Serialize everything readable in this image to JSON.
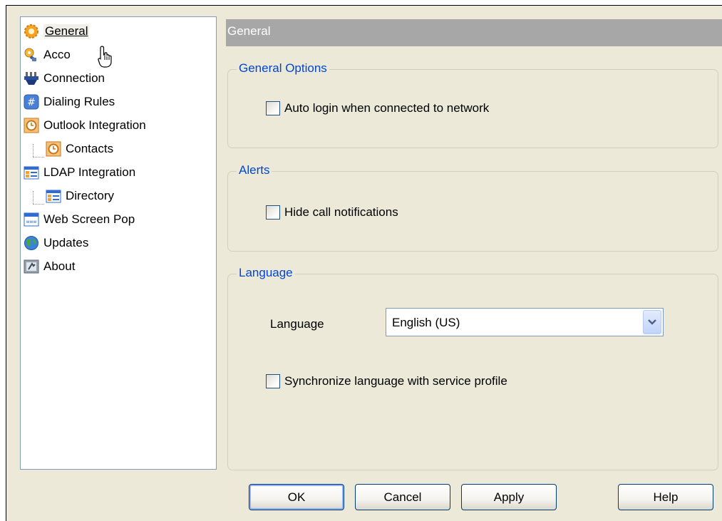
{
  "tree": {
    "items": [
      {
        "label": "General",
        "icon": "gear-icon"
      },
      {
        "label": "Acco",
        "icon": "account-key-icon"
      },
      {
        "label": "Connection",
        "icon": "connection-plug-icon"
      },
      {
        "label": "Dialing Rules",
        "icon": "hash-icon"
      },
      {
        "label": "Outlook Integration",
        "icon": "clock-icon"
      },
      {
        "label": "Contacts",
        "icon": "clock-icon"
      },
      {
        "label": "LDAP Integration",
        "icon": "directory-icon"
      },
      {
        "label": "Directory",
        "icon": "directory-icon"
      },
      {
        "label": "Web Screen Pop",
        "icon": "web-window-icon"
      },
      {
        "label": "Updates",
        "icon": "globe-icon"
      },
      {
        "label": "About",
        "icon": "about-icon"
      }
    ],
    "selected": "General"
  },
  "header": {
    "title": "General"
  },
  "general_options": {
    "title": "General Options",
    "auto_login_label": "Auto login when connected to network",
    "auto_login_checked": false
  },
  "alerts": {
    "title": "Alerts",
    "hide_notifications_label": "Hide call notifications",
    "hide_notifications_checked": false
  },
  "language": {
    "title": "Language",
    "label": "Language",
    "selected": "English (US)",
    "sync_label": "Synchronize language with service profile",
    "sync_checked": false
  },
  "buttons": {
    "ok": "OK",
    "cancel": "Cancel",
    "apply": "Apply",
    "help": "Help"
  },
  "colors": {
    "dialog_bg": "#ece9d8",
    "group_title": "#0046d5",
    "header_bg": "#a7a7a7"
  }
}
